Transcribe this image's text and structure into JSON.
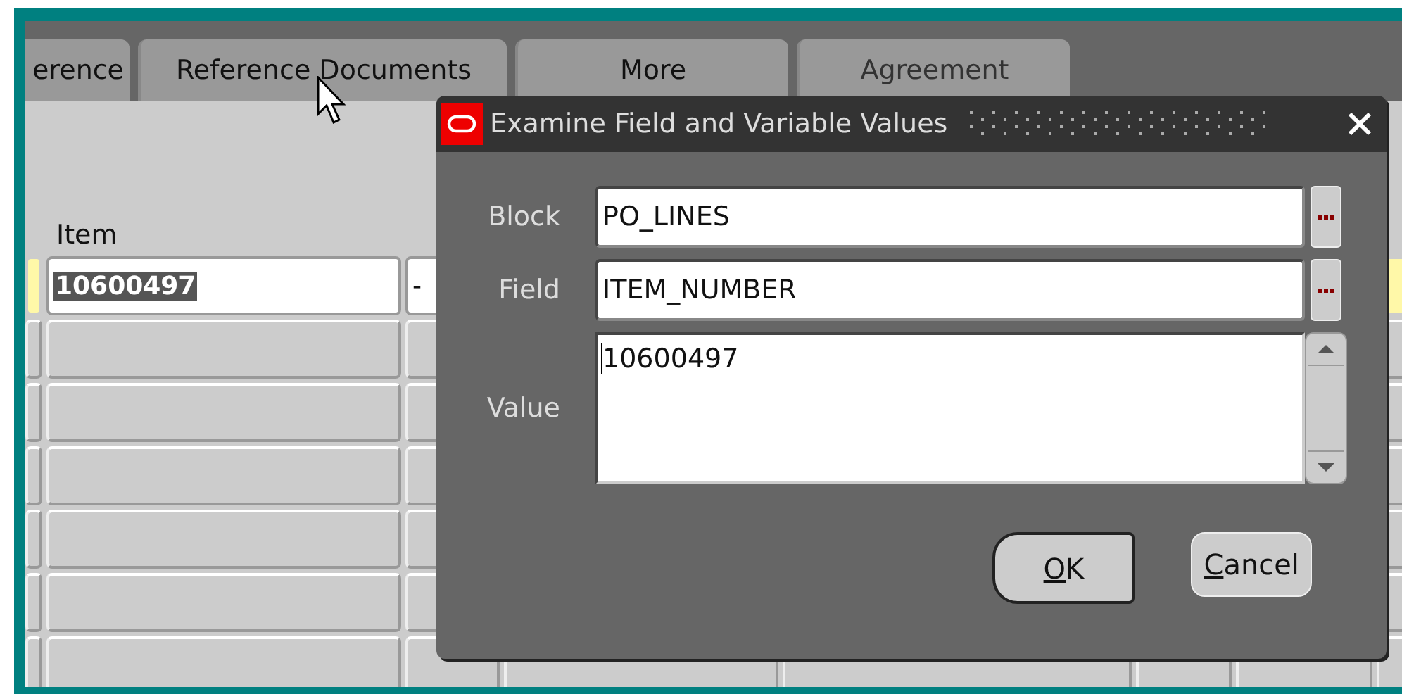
{
  "tabs": [
    {
      "label": "erence",
      "selected": false
    },
    {
      "label": "Reference Documents",
      "selected": false
    },
    {
      "label": "More",
      "selected": false
    },
    {
      "label": "Agreement",
      "selected": false
    }
  ],
  "table": {
    "columns": [
      {
        "label": "Item"
      }
    ],
    "rows": [
      {
        "current": true,
        "item": "10600497",
        "item_selected": true,
        "column_2": "-"
      },
      {
        "current": false
      },
      {
        "current": false
      },
      {
        "current": false
      },
      {
        "current": false
      },
      {
        "current": false
      },
      {
        "current": false
      }
    ]
  },
  "dialog": {
    "title": "Examine Field and Variable Values",
    "fields": [
      {
        "kind": "lov",
        "label": "Block",
        "value": "PO_LINES"
      },
      {
        "kind": "lov",
        "label": "Field",
        "value": "ITEM_NUMBER"
      },
      {
        "kind": "multiline",
        "label": "Value",
        "value": "10600497"
      }
    ],
    "buttons": [
      {
        "label": "OK",
        "default": true
      },
      {
        "label": "Cancel",
        "default": false
      }
    ]
  }
}
